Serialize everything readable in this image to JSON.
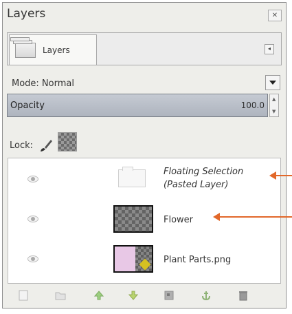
{
  "window": {
    "title": "Layers",
    "close_icon": "close-icon"
  },
  "tab": {
    "label": "Layers",
    "icon": "layers-stack-icon",
    "menu_icon": "tab-menu-icon"
  },
  "mode": {
    "label": "Mode: Normal",
    "dropdown_icon": "chevron-down-icon"
  },
  "opacity": {
    "label": "Opacity",
    "value": "100.0",
    "level": 1.0
  },
  "lock": {
    "label": "Lock:",
    "icons": [
      "paintbrush-icon",
      "alpha-lock-icon"
    ]
  },
  "layers": [
    {
      "name_line1": "Floating Selection",
      "name_line2": "(Pasted Layer)",
      "visible": true,
      "thumb": "floating-selection-thumbnail"
    },
    {
      "name": "Flower",
      "visible": true,
      "thumb": "transparent-layer-thumbnail"
    },
    {
      "name": "Plant Parts.png",
      "visible": true,
      "thumb": "plant-parts-thumbnail"
    }
  ],
  "toolbar": {
    "buttons": [
      "new-layer-icon",
      "new-layer-group-icon",
      "raise-layer-icon",
      "lower-layer-icon",
      "duplicate-layer-icon",
      "anchor-layer-icon",
      "delete-layer-icon"
    ]
  },
  "annotation": {
    "color": "#e2682a"
  }
}
